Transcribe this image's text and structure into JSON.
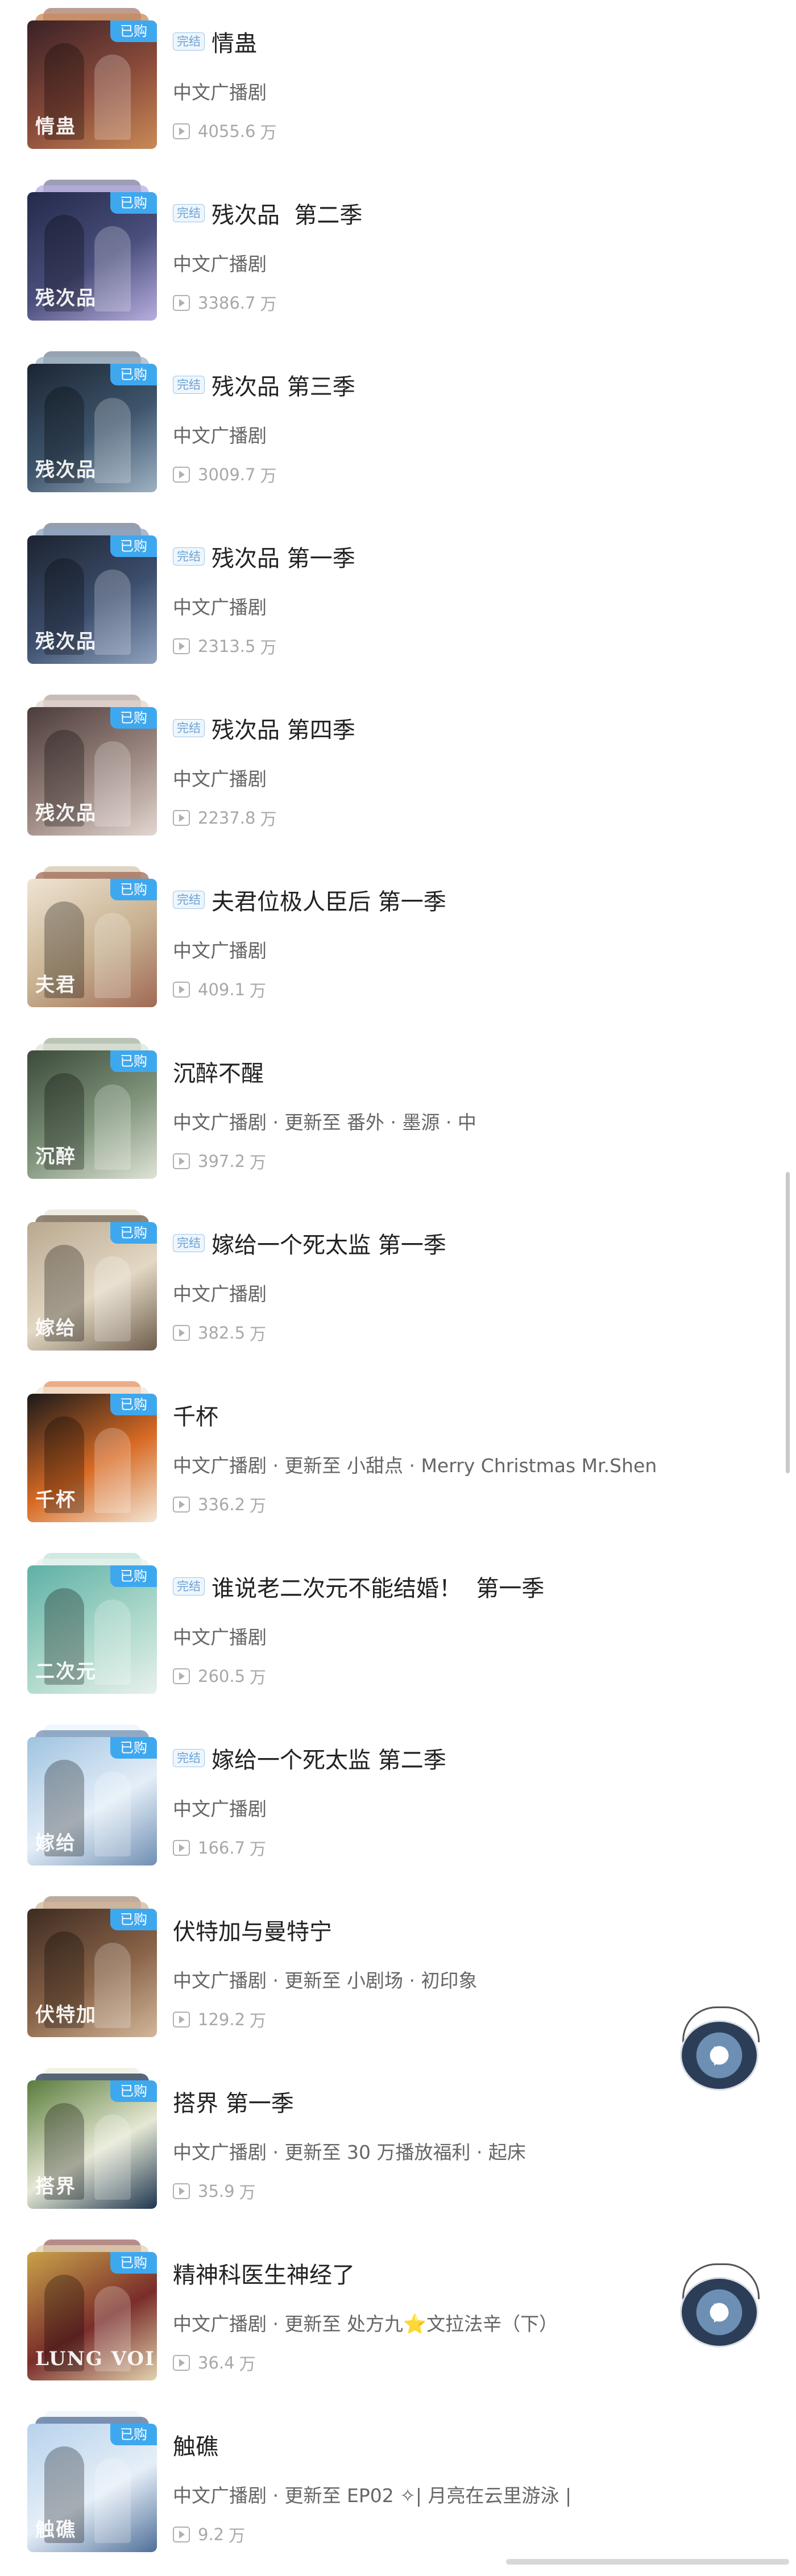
{
  "labels": {
    "purchased": "已购",
    "completed": "完结",
    "category": "中文广播剧",
    "update_prefix": "更新至",
    "sep": " · ",
    "unit": "万"
  },
  "items": [
    {
      "title": "情蛊",
      "completed": true,
      "update": "",
      "plays": "4055.6",
      "cover_text": "情蛊",
      "colors": [
        "#3a2126",
        "#8a4b3a",
        "#c98a58"
      ]
    },
    {
      "title": "残次品  第二季",
      "completed": true,
      "update": "",
      "plays": "3386.7",
      "cover_text": "残次品",
      "colors": [
        "#232a4a",
        "#4a4f7c",
        "#b7aee0"
      ]
    },
    {
      "title": "残次品 第三季",
      "completed": true,
      "update": "",
      "plays": "3009.7",
      "cover_text": "残次品",
      "colors": [
        "#1b2532",
        "#3f566e",
        "#9eb2c3"
      ]
    },
    {
      "title": "残次品 第一季",
      "completed": true,
      "update": "",
      "plays": "2313.5",
      "cover_text": "残次品",
      "colors": [
        "#1c2330",
        "#3d4f6e",
        "#8fa3c0"
      ]
    },
    {
      "title": "残次品 第四季",
      "completed": true,
      "update": "",
      "plays": "2237.8",
      "cover_text": "残次品",
      "colors": [
        "#4b3c3a",
        "#9b8680",
        "#e3d6d0"
      ]
    },
    {
      "title": "夫君位极人臣后 第一季",
      "completed": true,
      "update": "",
      "plays": "409.1",
      "cover_text": "夫君",
      "colors": [
        "#efe4d3",
        "#c7b08f",
        "#a06a55"
      ]
    },
    {
      "title": "沉醉不醒",
      "completed": false,
      "update": "番外 · 墨源 · 中",
      "plays": "397.2",
      "cover_text": "沉醉",
      "colors": [
        "#3c4a3a",
        "#7f947b",
        "#dfe3d6"
      ]
    },
    {
      "title": "嫁给一个死太监 第一季",
      "completed": true,
      "update": "",
      "plays": "382.5",
      "cover_text": "嫁给",
      "colors": [
        "#b9a88f",
        "#e3d8c4",
        "#6e5d4c"
      ]
    },
    {
      "title": "千杯",
      "completed": false,
      "update": "小甜点 · Merry Christmas Mr.Shen",
      "plays": "336.2",
      "cover_text": "千杯",
      "colors": [
        "#1a1a1a",
        "#d86a24",
        "#f3e7d6"
      ]
    },
    {
      "title": "谁说老二次元不能结婚！  第一季",
      "completed": true,
      "update": "",
      "plays": "260.5",
      "cover_text": "二次元",
      "colors": [
        "#5fb0a6",
        "#a9d7c9",
        "#e7f1ec"
      ]
    },
    {
      "title": "嫁给一个死太监 第二季",
      "completed": true,
      "update": "",
      "plays": "166.7",
      "cover_text": "嫁给",
      "colors": [
        "#9fc3e0",
        "#e4eef8",
        "#6f8fb3"
      ]
    },
    {
      "title": "伏特加与曼特宁",
      "completed": false,
      "update": "小剧场 · 初印象",
      "plays": "129.2",
      "cover_text": "伏特加",
      "colors": [
        "#3d2b22",
        "#8a6448",
        "#d2b79a"
      ]
    },
    {
      "title": "搭界 第一季",
      "completed": false,
      "update": "30 万播放福利 · 起床",
      "plays": "35.9",
      "cover_text": "搭界",
      "colors": [
        "#5a7c3b",
        "#e5e8d4",
        "#1f3650"
      ]
    },
    {
      "title": "精神科医生神经了",
      "completed": false,
      "update": "处方九⭐文拉法辛（下）",
      "plays": "36.4",
      "cover_text": "LUNG VOI",
      "colors": [
        "#c9a24a",
        "#7a2d2a",
        "#e2d2ae"
      ]
    },
    {
      "title": "触礁",
      "completed": false,
      "update": "EP02 ✧| 月亮在云里游泳 |",
      "plays": "9.2",
      "cover_text": "触礁",
      "colors": [
        "#b7d2ec",
        "#e6eff8",
        "#4f6f99"
      ]
    }
  ]
}
